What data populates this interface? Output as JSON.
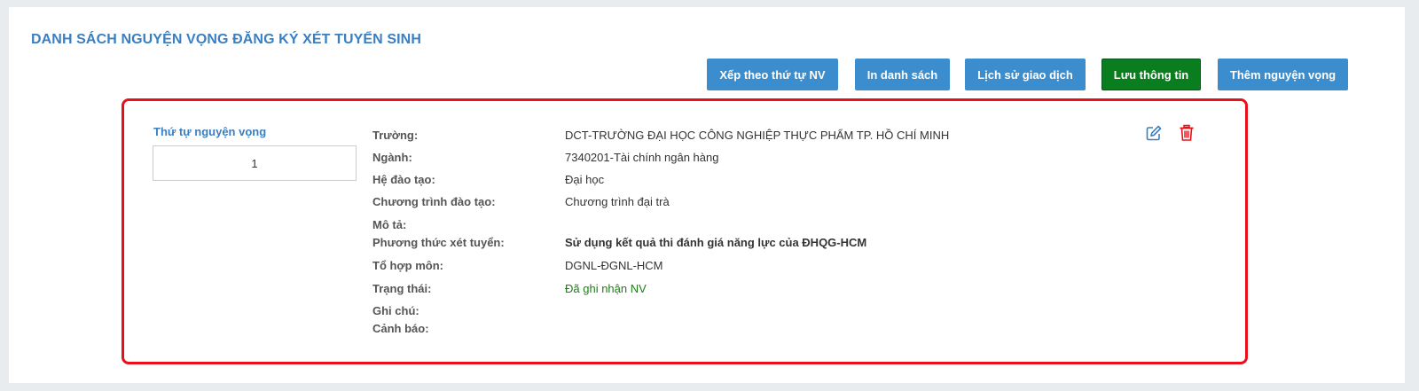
{
  "page": {
    "title": "DANH SÁCH NGUYỆN VỌNG ĐĂNG KÝ XÉT TUYỂN SINH"
  },
  "toolbar": {
    "sort_label": "Xếp theo thứ tự NV",
    "print_label": "In danh sách",
    "history_label": "Lịch sử giao dịch",
    "save_label": "Lưu thông tin",
    "add_label": "Thêm nguyện vọng"
  },
  "colors": {
    "accent_blue": "#3c8dcd",
    "save_green": "#0a7d1e",
    "highlight_red": "#e8101a",
    "status_green": "#1e7d17"
  },
  "icons": {
    "edit": "edit-icon",
    "delete": "trash-icon"
  },
  "wish": {
    "order_label": "Thứ tự nguyện vọng",
    "order_value": "1",
    "fields": {
      "school": {
        "label": "Trường:",
        "value": "DCT-TRƯỜNG ĐẠI HỌC CÔNG NGHIỆP THỰC PHẨM TP. HỒ CHÍ MINH"
      },
      "major": {
        "label": "Ngành:",
        "value": "7340201-Tài chính ngân hàng"
      },
      "training_system": {
        "label": "Hệ đào tạo:",
        "value": "Đại học"
      },
      "program": {
        "label": "Chương trình đào tạo:",
        "value": "Chương trình đại trà"
      },
      "description": {
        "label": "Mô tả:",
        "value": ""
      },
      "admission_method": {
        "label": "Phương thức xét tuyển:",
        "value": "Sử dụng kết quả thi đánh giá năng lực của ĐHQG-HCM"
      },
      "subject_combo": {
        "label": "Tổ hợp môn:",
        "value": "DGNL-ĐGNL-HCM"
      },
      "status": {
        "label": "Trạng thái:",
        "value": "Đã ghi nhận NV"
      },
      "note": {
        "label": "Ghi chú:",
        "value": ""
      },
      "warning": {
        "label": "Cảnh báo:",
        "value": ""
      }
    }
  }
}
